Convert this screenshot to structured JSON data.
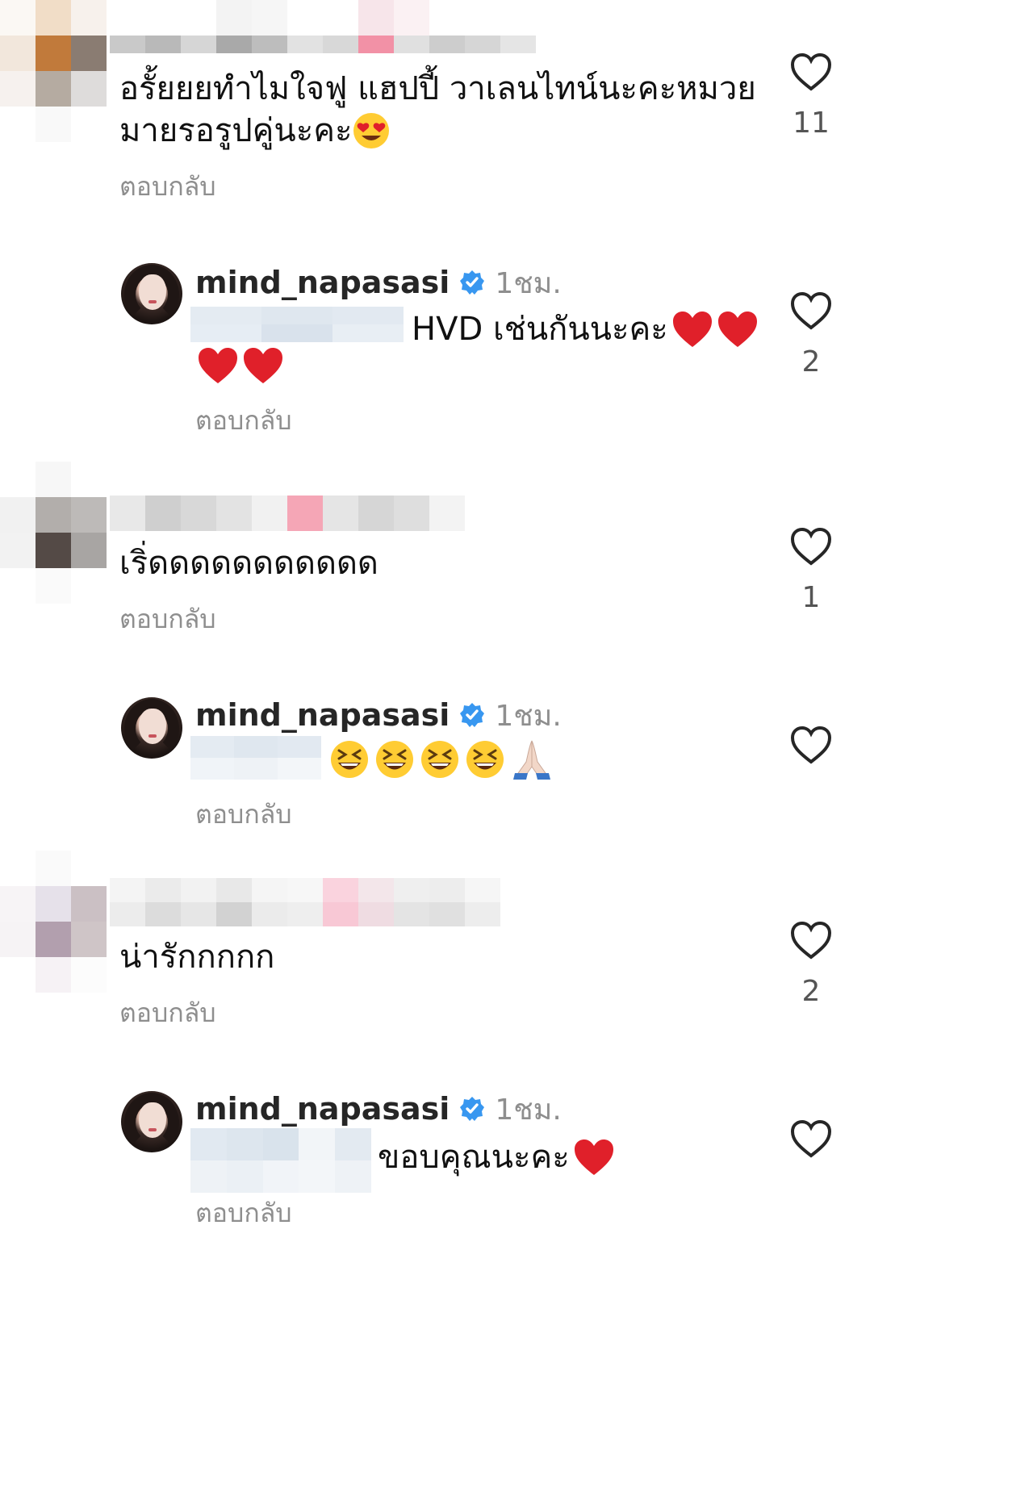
{
  "comments": [
    {
      "text_line1": "อรั้ยยยทำไมใจฟู แฮปปี้ วาเลนไทน์นะคะหมวย",
      "text_line2": "มายรอรูปคู่นะคะ",
      "text_emoji": "heart-eyes-emoji",
      "reply_label": "ตอบกลับ",
      "likes": "11"
    },
    {
      "username": "mind_napasasi",
      "time": "1ชม.",
      "text": "HVD เช่นกันนะคะ",
      "text_emoji": "red-heart-emoji",
      "reply_label": "ตอบกลับ",
      "likes": "2"
    },
    {
      "text": "เริ่ดดดดดดดดดดด",
      "reply_label": "ตอบกลับ",
      "likes": "1"
    },
    {
      "username": "mind_napasasi",
      "time": "1ชม.",
      "text_emoji": "grinning-squinting-emoji",
      "text_emoji2": "folded-hands-emoji",
      "reply_label": "ตอบกลับ"
    },
    {
      "text": "น่ารักกกกก",
      "reply_label": "ตอบกลับ",
      "likes": "2"
    },
    {
      "username": "mind_napasasi",
      "time": "1ชม.",
      "text": "ขอบคุณนะคะ",
      "text_emoji": "red-heart-emoji",
      "reply_label": "ตอบกลับ"
    }
  ],
  "colors": {
    "verified": "#3897f0",
    "heart_emoji": "#e0202a",
    "muted_text": "#8e8e8e"
  }
}
